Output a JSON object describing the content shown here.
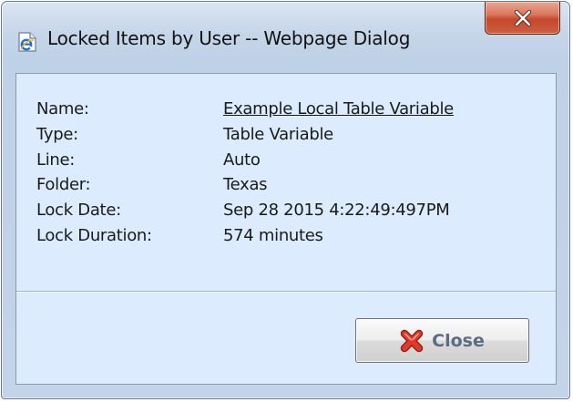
{
  "window": {
    "title": "Locked Items by User -- Webpage Dialog"
  },
  "details": [
    {
      "label": "Name:",
      "value": "Example Local Table Variable"
    },
    {
      "label": "Type:",
      "value": "Table Variable"
    },
    {
      "label": "Line:",
      "value": "Auto"
    },
    {
      "label": "Folder:",
      "value": "Texas"
    },
    {
      "label": "Lock Date:",
      "value": "Sep 28 2015 4:22:49:497PM"
    },
    {
      "label": "Lock Duration:",
      "value": "574 minutes"
    }
  ],
  "footer": {
    "close_label": "Close"
  },
  "icons": {
    "title_icon": "ie-page-icon",
    "window_close": "close-x-icon",
    "close_button_icon": "red-x-icon"
  },
  "colors": {
    "client_background": "#dcebfd",
    "titlebar_close": "#c4492c",
    "close_label": "#5a6d82"
  }
}
